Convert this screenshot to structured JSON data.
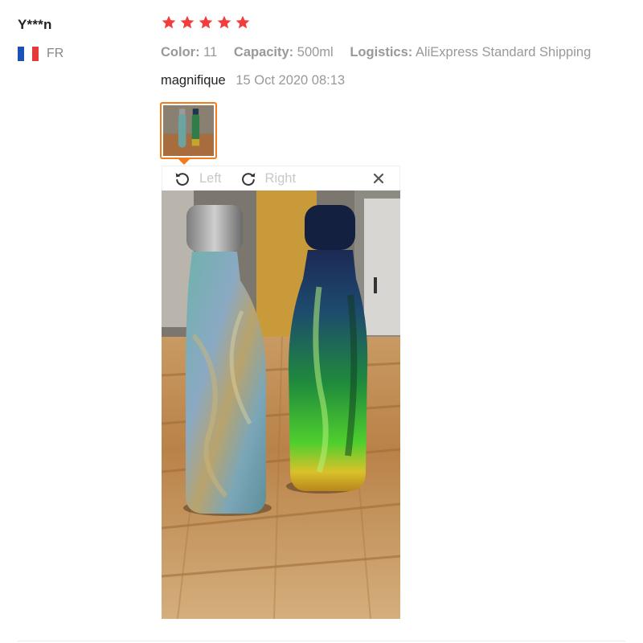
{
  "review": {
    "user": "Y***n",
    "country": "FR",
    "rating": 5,
    "meta": {
      "color_label": "Color:",
      "color_value": "11",
      "capacity_label": "Capacity:",
      "capacity_value": "500ml",
      "logistics_label": "Logistics:",
      "logistics_value": "AliExpress Standard Shipping"
    },
    "text": "magnifique",
    "date": "15 Oct 2020 08:13"
  },
  "viewer": {
    "rotate_left_label": "Left",
    "rotate_right_label": "Right"
  },
  "colors": {
    "star": "#f33d3d",
    "accent_orange": "#f07c1e",
    "muted_text": "#999999",
    "disabled_text": "#c8c8c8"
  },
  "icons": [
    "star-icon",
    "rotate-left-icon",
    "rotate-right-icon",
    "close-icon",
    "flag-fr-icon"
  ]
}
